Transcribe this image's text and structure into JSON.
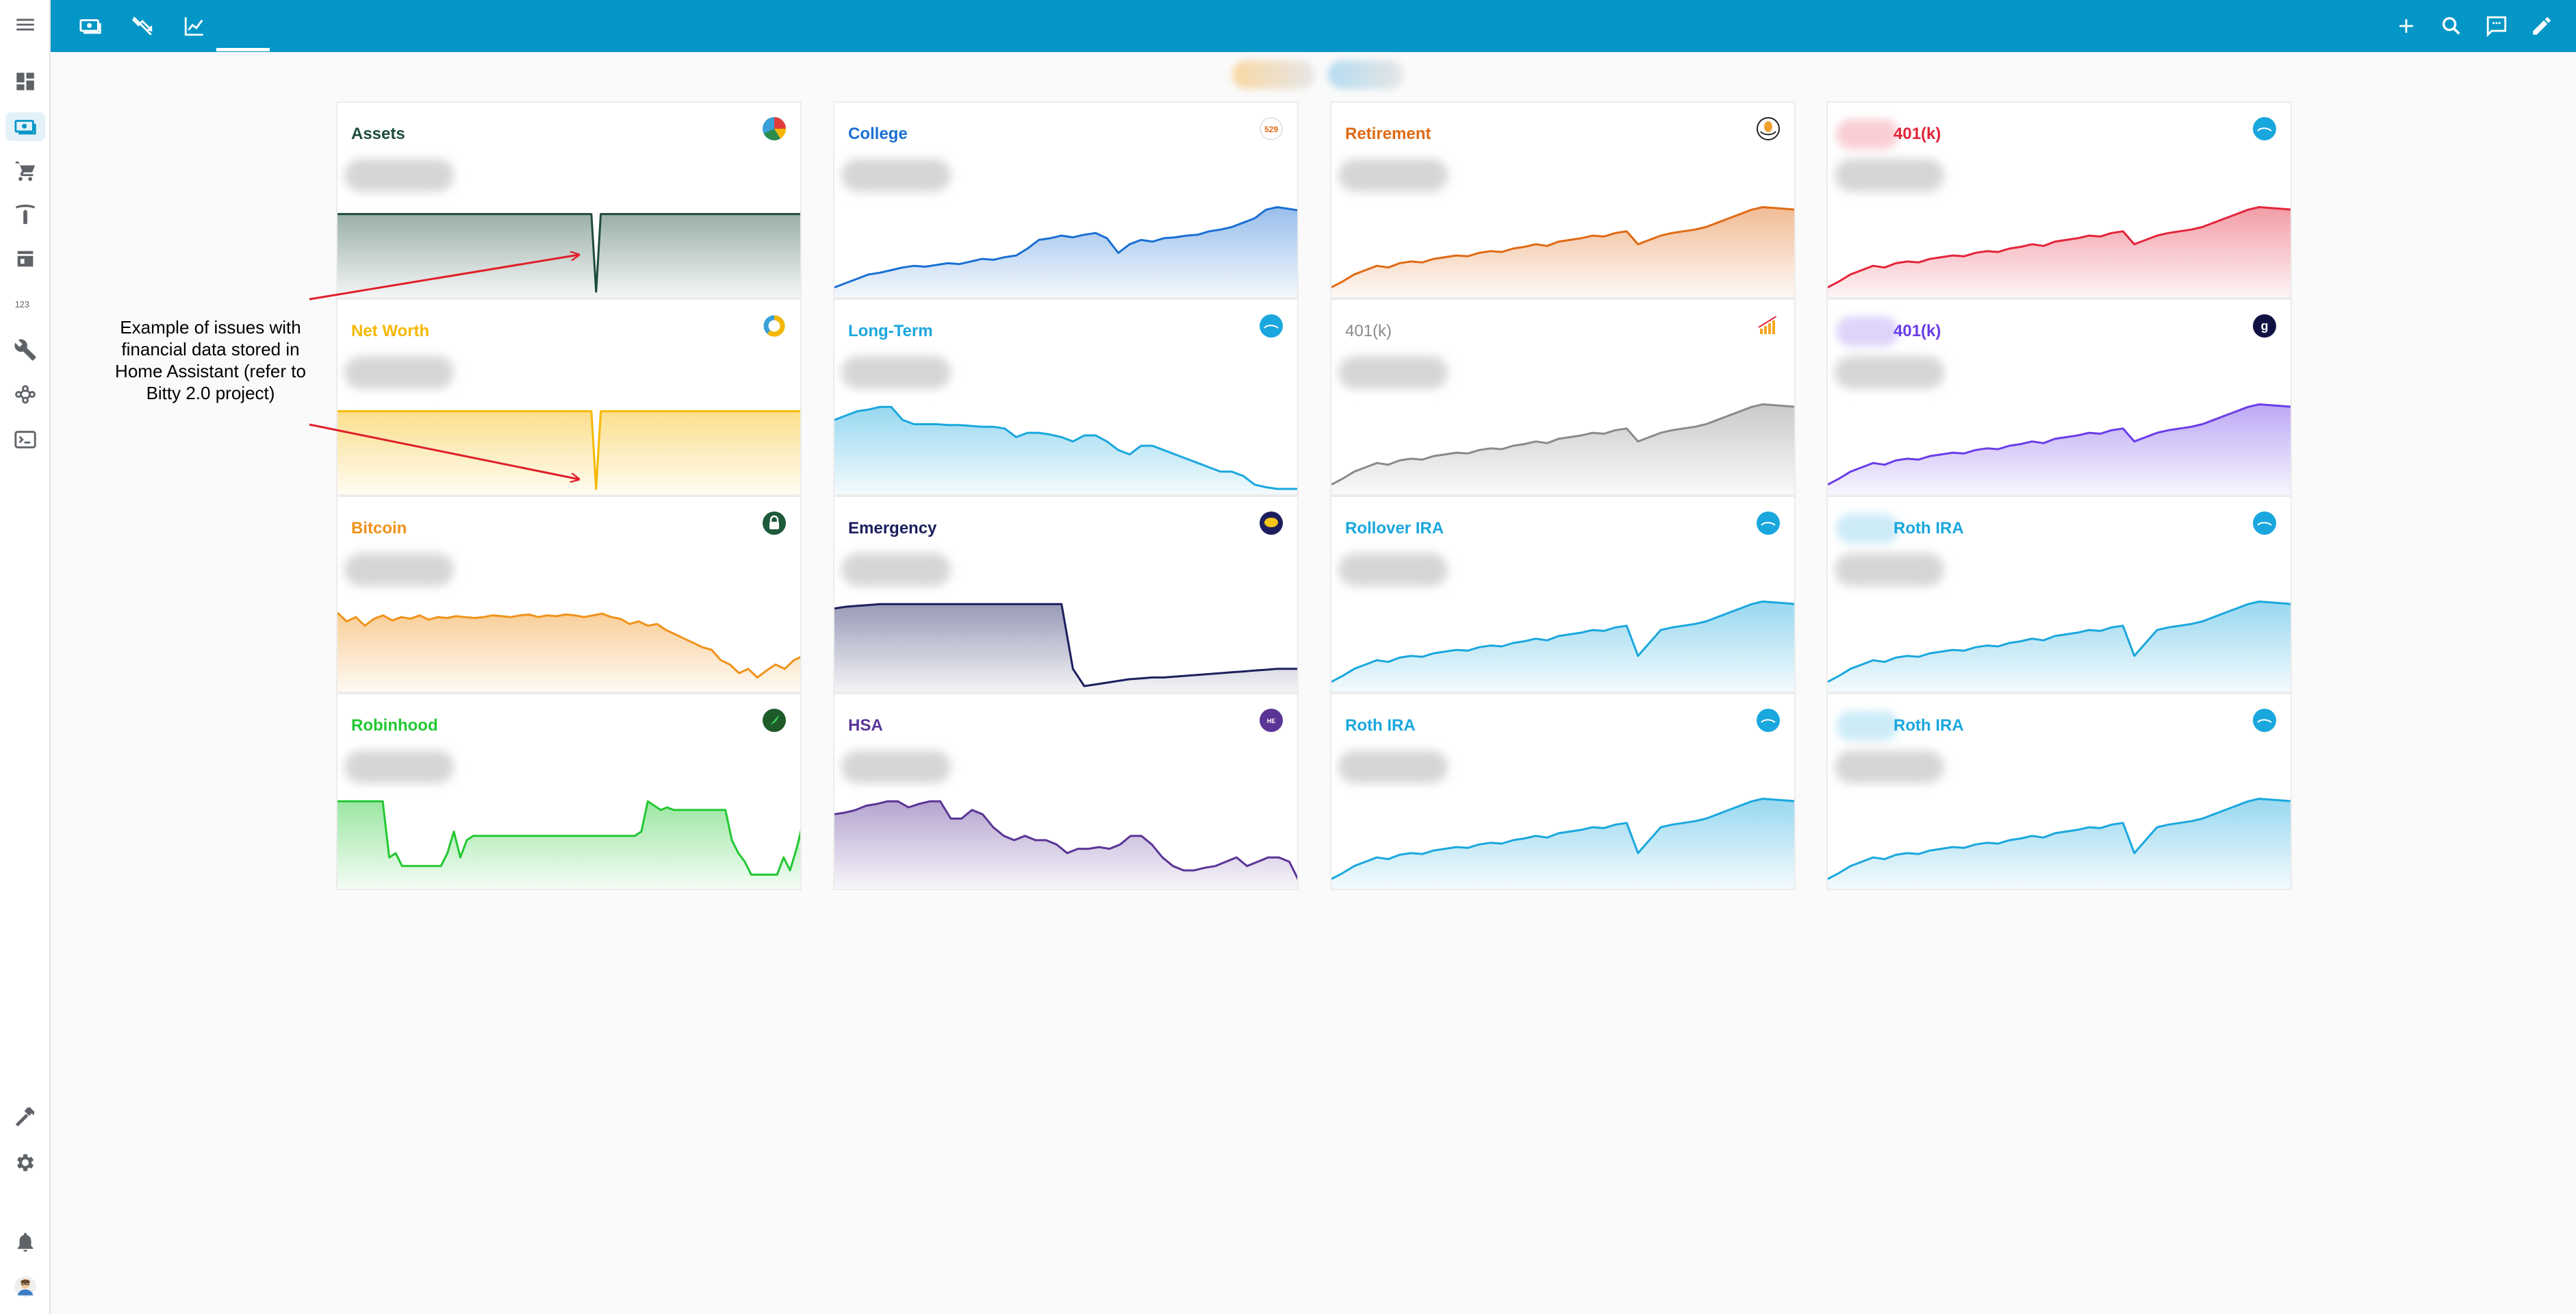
{
  "header": {
    "tabs": [
      {
        "icon": "cash-multiple-icon"
      },
      {
        "icon": "chart-line-down-icon"
      },
      {
        "icon": "chart-line-icon",
        "active": true
      }
    ],
    "actions": [
      "plus-icon",
      "search-icon",
      "assist-icon",
      "pencil-icon"
    ]
  },
  "sidebar": {
    "items": [
      "dashboard-icon",
      "cash-icon",
      "cart-icon",
      "tesla-icon",
      "store-icon",
      "counter-123-icon",
      "wrench-icon",
      "hub-icon",
      "console-icon"
    ],
    "bottom": [
      "hammer-icon",
      "gear-icon",
      "bell-icon",
      "user-avatar"
    ]
  },
  "annotation": {
    "text": "Example of issues with financial data stored in Home Assistant (refer to Bitty 2.0 project)",
    "color": "#000000",
    "arrow_color": "#e0202a"
  },
  "cards": [
    {
      "name": "Assets",
      "color": "#1e4d3a",
      "logo": "pie-chart-icon",
      "series": [
        0.9,
        0.9,
        0.9,
        0.9,
        0.9,
        0.9,
        0.9,
        0.9,
        0.9,
        0.9,
        0.9,
        0.9,
        0.9,
        0.9,
        0.9,
        0.9,
        0.9,
        0.9,
        0.9,
        0.9,
        0.9,
        0.9,
        0.9,
        0.9,
        0.9,
        0.9,
        0.9,
        0.9,
        0.9,
        0.9,
        0.9,
        0.9,
        0.9,
        0.9,
        0.9,
        0.9,
        0.9,
        0.9,
        0.9,
        0.9,
        0.9,
        0.9,
        0.9,
        0.9,
        0.9,
        0.9,
        0.9,
        0.9,
        0.9,
        0.9,
        0.9,
        0.9,
        0.9,
        0.9,
        0.9,
        0.0,
        0.9,
        0.9,
        0.9,
        0.9,
        0.9,
        0.9,
        0.9,
        0.9,
        0.9,
        0.9,
        0.9,
        0.9,
        0.9,
        0.9,
        0.9,
        0.9,
        0.9,
        0.9,
        0.9,
        0.9,
        0.9,
        0.9,
        0.9,
        0.9,
        0.9,
        0.9,
        0.9,
        0.9,
        0.9,
        0.9,
        0.9,
        0.9,
        0.9,
        0.9,
        0.9,
        0.9,
        0.9,
        0.9,
        0.9,
        0.9,
        0.9,
        0.9,
        0.9,
        0.9
      ]
    },
    {
      "name": "College",
      "color": "#1a6fd3",
      "logo": "529-icon",
      "series": [
        0.05,
        0.1,
        0.15,
        0.2,
        0.22,
        0.25,
        0.28,
        0.3,
        0.29,
        0.31,
        0.33,
        0.32,
        0.35,
        0.38,
        0.37,
        0.4,
        0.42,
        0.5,
        0.6,
        0.62,
        0.65,
        0.63,
        0.66,
        0.68,
        0.62,
        0.45,
        0.55,
        0.6,
        0.58,
        0.62,
        0.63,
        0.65,
        0.66,
        0.7,
        0.72,
        0.75,
        0.8,
        0.85,
        0.95,
        0.98,
        0.96,
        0.94
      ]
    },
    {
      "name": "Retirement",
      "color": "#e06a14",
      "logo": "nest-egg-icon",
      "series": [
        0.05,
        0.12,
        0.2,
        0.25,
        0.3,
        0.28,
        0.33,
        0.35,
        0.34,
        0.38,
        0.4,
        0.42,
        0.41,
        0.45,
        0.47,
        0.46,
        0.5,
        0.52,
        0.55,
        0.53,
        0.58,
        0.6,
        0.62,
        0.65,
        0.64,
        0.68,
        0.7,
        0.55,
        0.6,
        0.65,
        0.68,
        0.7,
        0.72,
        0.75,
        0.8,
        0.85,
        0.9,
        0.95,
        0.98,
        0.97,
        0.96,
        0.95
      ]
    },
    {
      "name": "401(k)",
      "color": "#e3253a",
      "logo": "brokerage-icon",
      "blurred_prefix": true,
      "series": [
        0.05,
        0.12,
        0.2,
        0.25,
        0.3,
        0.28,
        0.33,
        0.35,
        0.34,
        0.38,
        0.4,
        0.42,
        0.41,
        0.45,
        0.47,
        0.46,
        0.5,
        0.52,
        0.55,
        0.53,
        0.58,
        0.6,
        0.62,
        0.65,
        0.64,
        0.68,
        0.7,
        0.55,
        0.6,
        0.65,
        0.68,
        0.7,
        0.72,
        0.75,
        0.8,
        0.85,
        0.9,
        0.95,
        0.98,
        0.97,
        0.96,
        0.95
      ]
    },
    {
      "name": "Net Worth",
      "color": "#f5b800",
      "logo": "donut-chart-icon",
      "series": [
        0.9,
        0.9,
        0.9,
        0.9,
        0.9,
        0.9,
        0.9,
        0.9,
        0.9,
        0.9,
        0.9,
        0.9,
        0.9,
        0.9,
        0.9,
        0.9,
        0.9,
        0.9,
        0.9,
        0.9,
        0.9,
        0.9,
        0.9,
        0.9,
        0.9,
        0.9,
        0.9,
        0.9,
        0.9,
        0.9,
        0.9,
        0.9,
        0.9,
        0.9,
        0.9,
        0.9,
        0.9,
        0.9,
        0.9,
        0.9,
        0.9,
        0.9,
        0.9,
        0.9,
        0.9,
        0.9,
        0.9,
        0.9,
        0.9,
        0.9,
        0.9,
        0.9,
        0.9,
        0.9,
        0.9,
        0.0,
        0.9,
        0.9,
        0.9,
        0.9,
        0.9,
        0.9,
        0.9,
        0.9,
        0.9,
        0.9,
        0.9,
        0.9,
        0.9,
        0.9,
        0.9,
        0.9,
        0.9,
        0.9,
        0.9,
        0.9,
        0.9,
        0.9,
        0.9,
        0.9,
        0.9,
        0.9,
        0.9,
        0.9,
        0.9,
        0.9,
        0.9,
        0.9,
        0.9,
        0.9,
        0.9,
        0.9,
        0.9,
        0.9,
        0.9,
        0.9,
        0.9,
        0.9,
        0.9,
        0.9
      ]
    },
    {
      "name": "Long-Term",
      "color": "#1aa7dd",
      "logo": "brokerage-icon",
      "series": [
        0.8,
        0.85,
        0.9,
        0.92,
        0.95,
        0.95,
        0.8,
        0.75,
        0.75,
        0.75,
        0.74,
        0.74,
        0.73,
        0.72,
        0.72,
        0.7,
        0.6,
        0.65,
        0.65,
        0.63,
        0.6,
        0.55,
        0.62,
        0.62,
        0.55,
        0.45,
        0.4,
        0.5,
        0.5,
        0.45,
        0.4,
        0.35,
        0.3,
        0.25,
        0.2,
        0.2,
        0.15,
        0.05,
        0.02,
        0.0,
        0.0,
        0.0
      ]
    },
    {
      "name": "401(k)",
      "color": "#8a8a8a",
      "logo": "growth-chart-icon",
      "plain": true,
      "series": [
        0.05,
        0.12,
        0.2,
        0.25,
        0.3,
        0.28,
        0.33,
        0.35,
        0.34,
        0.38,
        0.4,
        0.42,
        0.41,
        0.45,
        0.47,
        0.46,
        0.5,
        0.52,
        0.55,
        0.53,
        0.58,
        0.6,
        0.62,
        0.65,
        0.64,
        0.68,
        0.7,
        0.55,
        0.6,
        0.65,
        0.68,
        0.7,
        0.72,
        0.75,
        0.8,
        0.85,
        0.9,
        0.95,
        0.98,
        0.97,
        0.96,
        0.95
      ]
    },
    {
      "name": "401(k)",
      "color": "#6a3de8",
      "logo": "g-icon",
      "blurred_prefix": true,
      "series": [
        0.05,
        0.12,
        0.2,
        0.25,
        0.3,
        0.28,
        0.33,
        0.35,
        0.34,
        0.38,
        0.4,
        0.42,
        0.41,
        0.45,
        0.47,
        0.46,
        0.5,
        0.52,
        0.55,
        0.53,
        0.58,
        0.6,
        0.62,
        0.65,
        0.64,
        0.68,
        0.7,
        0.55,
        0.6,
        0.65,
        0.68,
        0.7,
        0.72,
        0.75,
        0.8,
        0.85,
        0.9,
        0.95,
        0.98,
        0.97,
        0.96,
        0.95
      ]
    },
    {
      "name": "Bitcoin",
      "color": "#f0921a",
      "logo": "lock-icon",
      "series": [
        0.85,
        0.75,
        0.8,
        0.7,
        0.78,
        0.82,
        0.76,
        0.8,
        0.78,
        0.82,
        0.77,
        0.8,
        0.79,
        0.81,
        0.8,
        0.79,
        0.8,
        0.82,
        0.81,
        0.8,
        0.82,
        0.83,
        0.8,
        0.82,
        0.81,
        0.83,
        0.82,
        0.8,
        0.82,
        0.84,
        0.8,
        0.78,
        0.72,
        0.75,
        0.7,
        0.72,
        0.65,
        0.6,
        0.55,
        0.5,
        0.45,
        0.42,
        0.3,
        0.25,
        0.15,
        0.2,
        0.1,
        0.18,
        0.25,
        0.2,
        0.3,
        0.35
      ]
    },
    {
      "name": "Emergency",
      "color": "#1c1f5e",
      "logo": "savings-icon",
      "series": [
        0.9,
        0.92,
        0.93,
        0.94,
        0.95,
        0.95,
        0.95,
        0.95,
        0.95,
        0.95,
        0.95,
        0.95,
        0.95,
        0.95,
        0.95,
        0.95,
        0.95,
        0.95,
        0.95,
        0.95,
        0.95,
        0.2,
        0.0,
        0.02,
        0.04,
        0.06,
        0.08,
        0.09,
        0.1,
        0.1,
        0.11,
        0.12,
        0.13,
        0.14,
        0.15,
        0.16,
        0.17,
        0.18,
        0.19,
        0.2,
        0.2,
        0.2
      ]
    },
    {
      "name": "Rollover IRA",
      "color": "#1aa7dd",
      "logo": "brokerage-icon",
      "series": [
        0.05,
        0.12,
        0.2,
        0.25,
        0.3,
        0.28,
        0.33,
        0.35,
        0.34,
        0.38,
        0.4,
        0.42,
        0.41,
        0.45,
        0.47,
        0.46,
        0.5,
        0.52,
        0.55,
        0.53,
        0.58,
        0.6,
        0.62,
        0.65,
        0.64,
        0.68,
        0.7,
        0.35,
        0.5,
        0.65,
        0.68,
        0.7,
        0.72,
        0.75,
        0.8,
        0.85,
        0.9,
        0.95,
        0.98,
        0.97,
        0.96,
        0.95
      ]
    },
    {
      "name": "Roth IRA",
      "color": "#1aa7dd",
      "logo": "brokerage-icon",
      "blurred_prefix": true,
      "series": [
        0.05,
        0.12,
        0.2,
        0.25,
        0.3,
        0.28,
        0.33,
        0.35,
        0.34,
        0.38,
        0.4,
        0.42,
        0.41,
        0.45,
        0.47,
        0.46,
        0.5,
        0.52,
        0.55,
        0.53,
        0.58,
        0.6,
        0.62,
        0.65,
        0.64,
        0.68,
        0.7,
        0.35,
        0.5,
        0.65,
        0.68,
        0.7,
        0.72,
        0.75,
        0.8,
        0.85,
        0.9,
        0.95,
        0.98,
        0.97,
        0.96,
        0.95
      ]
    },
    {
      "name": "Robinhood",
      "color": "#22c832",
      "logo": "feather-icon",
      "series": [
        0.95,
        0.95,
        0.95,
        0.95,
        0.95,
        0.95,
        0.95,
        0.95,
        0.3,
        0.35,
        0.2,
        0.2,
        0.2,
        0.2,
        0.2,
        0.2,
        0.2,
        0.35,
        0.6,
        0.3,
        0.5,
        0.55,
        0.55,
        0.55,
        0.55,
        0.55,
        0.55,
        0.55,
        0.55,
        0.55,
        0.55,
        0.55,
        0.55,
        0.55,
        0.55,
        0.55,
        0.55,
        0.55,
        0.55,
        0.55,
        0.55,
        0.55,
        0.55,
        0.55,
        0.55,
        0.55,
        0.55,
        0.6,
        0.95,
        0.9,
        0.85,
        0.88,
        0.85,
        0.85,
        0.85,
        0.85,
        0.85,
        0.85,
        0.85,
        0.85,
        0.85,
        0.5,
        0.35,
        0.25,
        0.1,
        0.1,
        0.1,
        0.1,
        0.1,
        0.3,
        0.15,
        0.4,
        0.7
      ]
    },
    {
      "name": "HSA",
      "color": "#5a3596",
      "logo": "health-equity-icon",
      "series": [
        0.8,
        0.82,
        0.85,
        0.9,
        0.92,
        0.95,
        0.95,
        0.88,
        0.92,
        0.95,
        0.95,
        0.75,
        0.75,
        0.85,
        0.8,
        0.65,
        0.55,
        0.5,
        0.55,
        0.5,
        0.5,
        0.45,
        0.35,
        0.4,
        0.4,
        0.42,
        0.4,
        0.45,
        0.55,
        0.55,
        0.45,
        0.3,
        0.2,
        0.15,
        0.15,
        0.18,
        0.2,
        0.25,
        0.3,
        0.2,
        0.25,
        0.3,
        0.3,
        0.25,
        0.0
      ]
    },
    {
      "name": "Roth IRA",
      "color": "#1aa7dd",
      "logo": "brokerage-icon",
      "series": [
        0.05,
        0.12,
        0.2,
        0.25,
        0.3,
        0.28,
        0.33,
        0.35,
        0.34,
        0.38,
        0.4,
        0.42,
        0.41,
        0.45,
        0.47,
        0.46,
        0.5,
        0.52,
        0.55,
        0.53,
        0.58,
        0.6,
        0.62,
        0.65,
        0.64,
        0.68,
        0.7,
        0.35,
        0.5,
        0.65,
        0.68,
        0.7,
        0.72,
        0.75,
        0.8,
        0.85,
        0.9,
        0.95,
        0.98,
        0.97,
        0.96,
        0.95
      ]
    },
    {
      "name": "Roth IRA",
      "color": "#1aa7dd",
      "logo": "brokerage-icon",
      "blurred_prefix": true,
      "series": [
        0.05,
        0.12,
        0.2,
        0.25,
        0.3,
        0.28,
        0.33,
        0.35,
        0.34,
        0.38,
        0.4,
        0.42,
        0.41,
        0.45,
        0.47,
        0.46,
        0.5,
        0.52,
        0.55,
        0.53,
        0.58,
        0.6,
        0.62,
        0.65,
        0.64,
        0.68,
        0.7,
        0.35,
        0.5,
        0.65,
        0.68,
        0.7,
        0.72,
        0.75,
        0.8,
        0.85,
        0.9,
        0.95,
        0.98,
        0.97,
        0.96,
        0.95
      ]
    }
  ]
}
